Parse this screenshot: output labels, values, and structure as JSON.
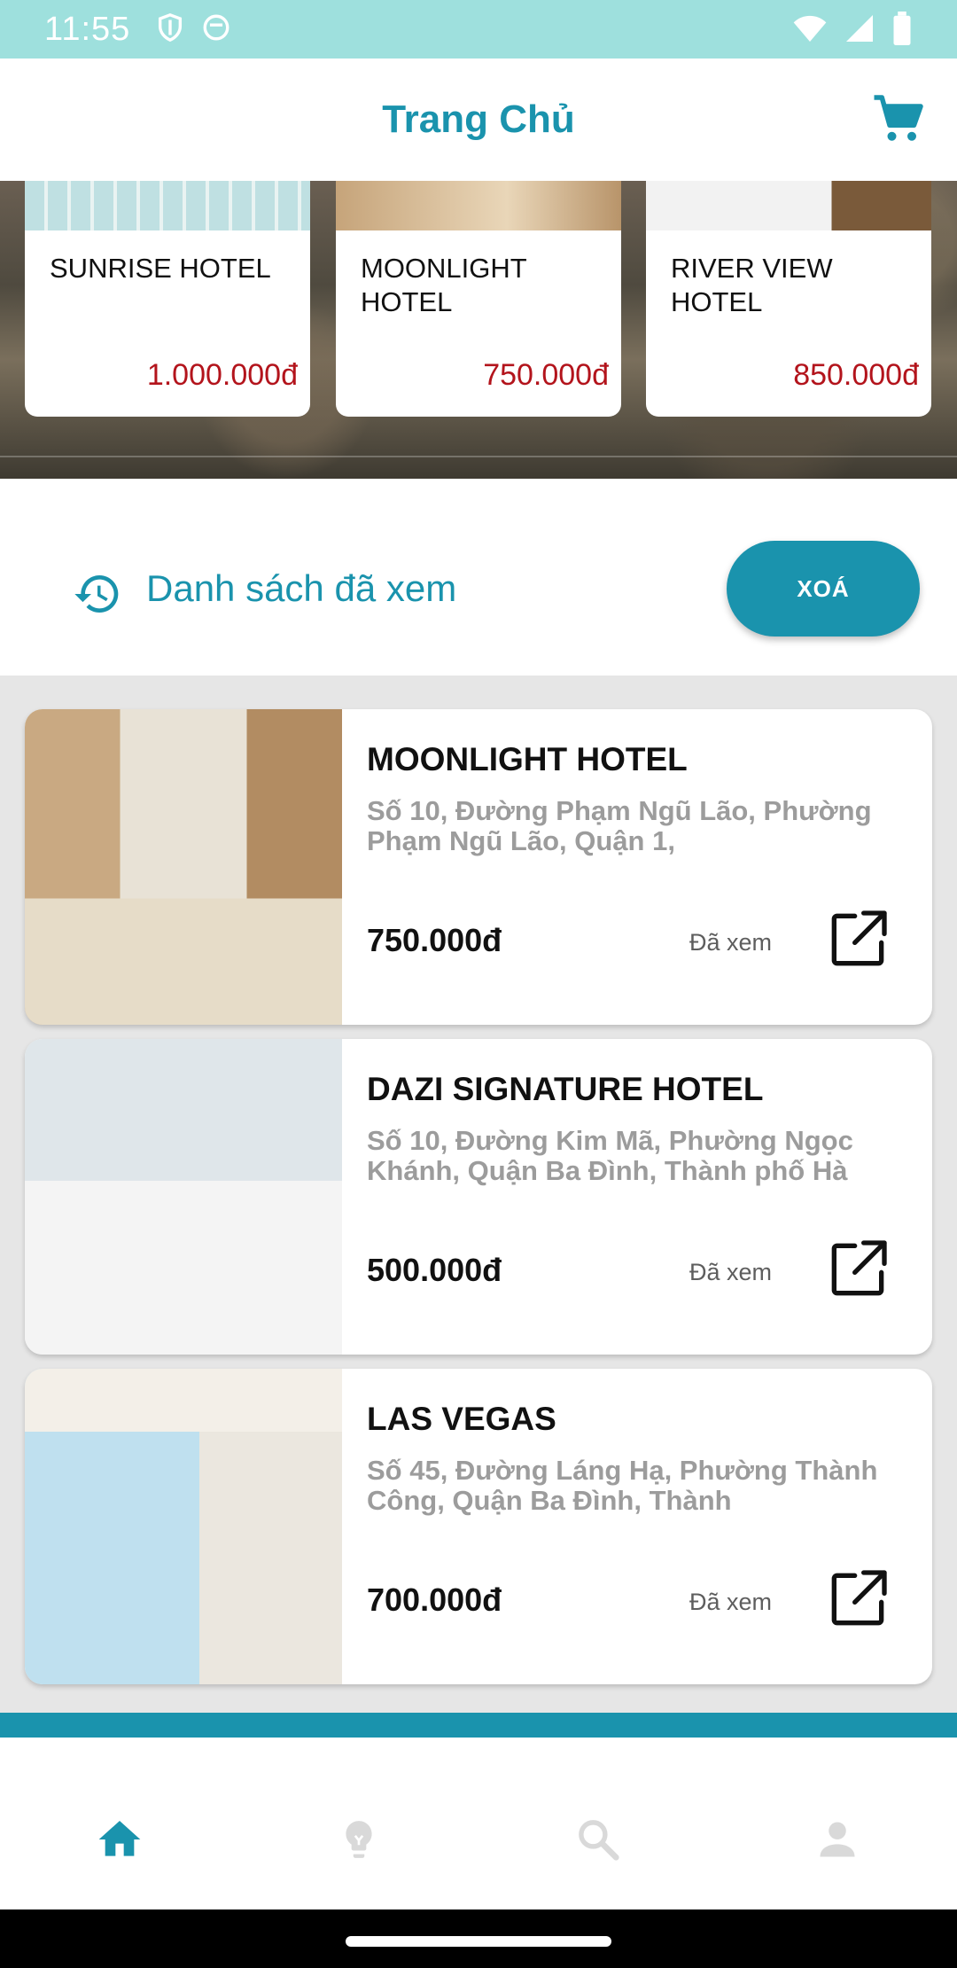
{
  "status_bar": {
    "time": "11:55",
    "icons_left": [
      "shield-icon",
      "face-icon"
    ],
    "icons_right": [
      "wifi-icon",
      "signal-icon",
      "battery-icon"
    ]
  },
  "app_bar": {
    "title": "Trang Chủ",
    "cart_icon": "cart-icon"
  },
  "featured": [
    {
      "name": "SUNRISE HOTEL",
      "price": "1.000.000đ"
    },
    {
      "name": "MOONLIGHT HOTEL",
      "price": "750.000đ"
    },
    {
      "name": "RIVER VIEW HOTEL",
      "price": "850.000đ"
    }
  ],
  "history": {
    "title": "Danh sách đã xem",
    "clear_label": "XOÁ",
    "icon": "history-icon"
  },
  "viewed": [
    {
      "name": "MOONLIGHT HOTEL",
      "address": "Số 10, Đường Phạm Ngũ Lão, Phường Phạm Ngũ Lão, Quận 1,",
      "price": "750.000đ",
      "status": "Đã xem"
    },
    {
      "name": "DAZI SIGNATURE HOTEL",
      "address": "Số 10, Đường Kim Mã, Phường Ngọc Khánh, Quận Ba Đình, Thành phố Hà",
      "price": "500.000đ",
      "status": "Đã xem"
    },
    {
      "name": "LAS VEGAS",
      "address": "Số 45, Đường Láng Hạ, Phường Thành Công, Quận Ba Đình, Thành",
      "price": "700.000đ",
      "status": "Đã xem"
    }
  ],
  "bottom_nav": {
    "items": [
      "home-icon",
      "lightbulb-icon",
      "search-icon",
      "person-icon"
    ],
    "active": "home-icon"
  },
  "colors": {
    "accent": "#1a93ad",
    "price_red": "#b3141c",
    "status_bar": "#9ee0dd"
  }
}
